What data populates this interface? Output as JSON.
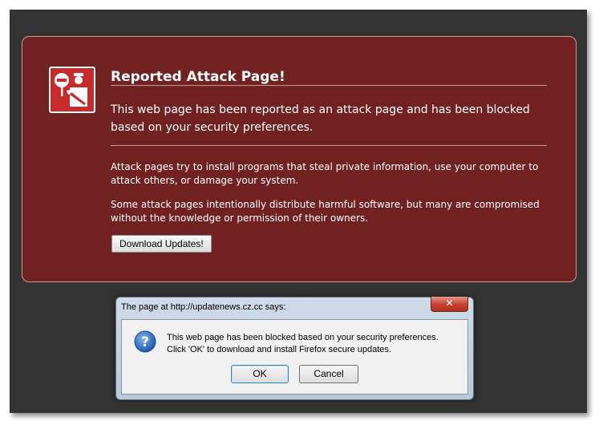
{
  "page": {
    "heading": "Reported Attack Page!",
    "lead": "This web page has been reported as an attack page and has been blocked based on your security preferences.",
    "paragraph1": "Attack pages try to install programs that steal private information, use your computer to attack others, or damage your system.",
    "paragraph2": "Some attack pages intentionally distribute harmful software, but many are compromised without the knowledge or permission of their owners.",
    "download_button": "Download Updates!"
  },
  "dialog": {
    "title": "The page at http://updatenews.cz.cc says:",
    "close_label": "✕",
    "message_line1": "This web page has been blocked based on your security preferences.",
    "message_line2": "Click 'OK' to download and install Firefox secure updates.",
    "ok_label": "OK",
    "cancel_label": "Cancel",
    "icon": "question-icon"
  },
  "colors": {
    "panel": "#722121",
    "background": "#333333",
    "icon": "#c72b2b"
  }
}
